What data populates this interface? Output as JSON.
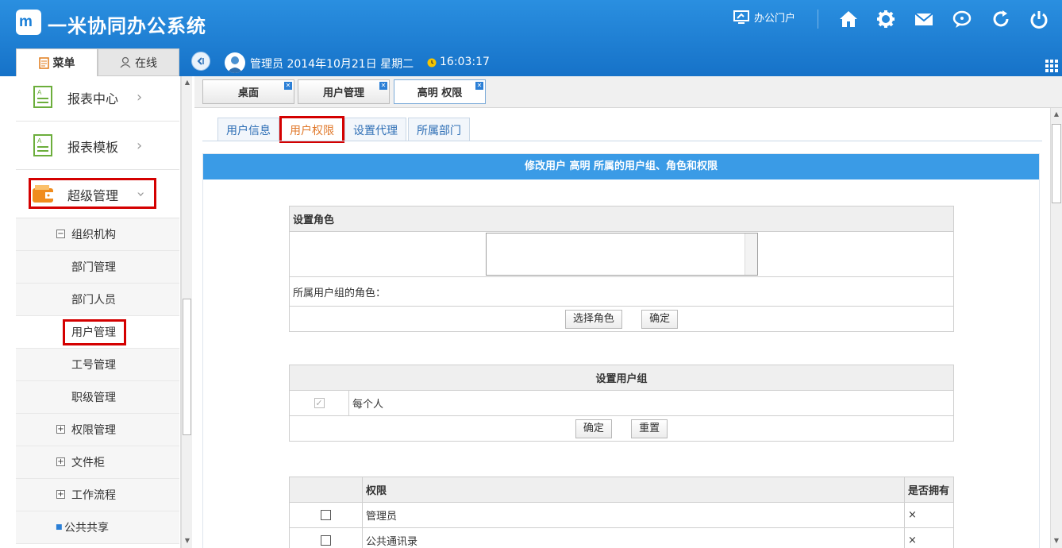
{
  "header": {
    "logo_text": "m",
    "app_title": "一米协同办公系统",
    "portal_label": "办公门户",
    "icons": [
      "monitor-icon",
      "home-icon",
      "gear-icon",
      "mail-icon",
      "chat-icon",
      "refresh-icon",
      "power-icon"
    ]
  },
  "sidebar_tabs": {
    "menu": "菜单",
    "online": "在线"
  },
  "userbar": {
    "user_info": "管理员 2014年10月21日 星期二",
    "time": "16:03:17"
  },
  "sidebar": {
    "big_items": [
      {
        "label": "报表中心"
      },
      {
        "label": "报表模板"
      },
      {
        "label": "超级管理"
      }
    ],
    "sub_items": [
      {
        "label": "组织机构",
        "tree": "−"
      },
      {
        "label": "部门管理"
      },
      {
        "label": "部门人员"
      },
      {
        "label": "用户管理"
      },
      {
        "label": "工号管理"
      },
      {
        "label": "职级管理"
      },
      {
        "label": "权限管理",
        "tree": "+"
      },
      {
        "label": "文件柜",
        "tree": "+"
      },
      {
        "label": "工作流程",
        "tree": "+"
      },
      {
        "label": "公共共享",
        "bullet": "■"
      }
    ]
  },
  "page_tabs": [
    {
      "label": "桌面"
    },
    {
      "label": "用户管理"
    },
    {
      "label": "高明 权限"
    }
  ],
  "inner_tabs": [
    {
      "label": "用户信息"
    },
    {
      "label": "用户权限"
    },
    {
      "label": "设置代理"
    },
    {
      "label": "所属部门"
    }
  ],
  "panel": {
    "title": "修改用户 高明 所属的用户组、角色和权限",
    "role": {
      "header": "设置角色",
      "group_roles_label": "所属用户组的角色：",
      "select_btn": "选择角色",
      "ok_btn": "确定"
    },
    "group": {
      "header": "设置用户组",
      "checkmark": "✓",
      "item": "每个人",
      "ok_btn": "确定",
      "reset_btn": "重置"
    },
    "perm": {
      "col_perm": "权限",
      "col_owned": "是否拥有",
      "rows": [
        {
          "name": "管理员",
          "owned": "×"
        },
        {
          "name": "公共通讯录",
          "owned": "×"
        }
      ]
    }
  },
  "colors": {
    "header_blue": "#1a7fd8",
    "accent_red": "#d40000",
    "title_blue": "#3a9be6",
    "tab_orange": "#e0782a"
  }
}
